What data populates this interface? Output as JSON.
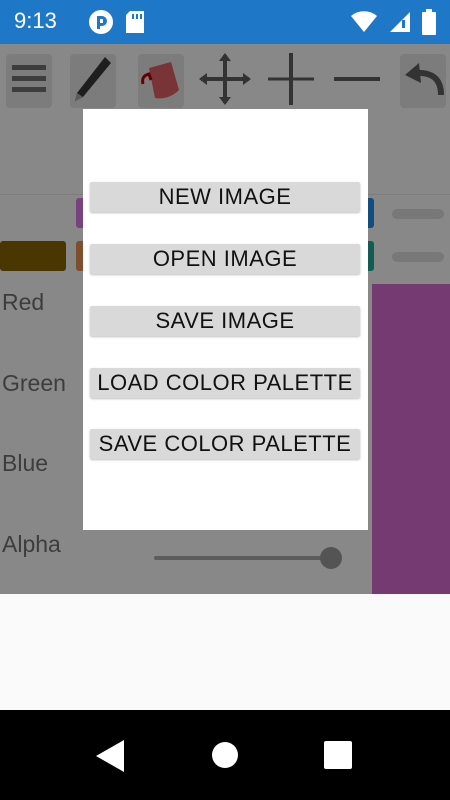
{
  "status_bar": {
    "time": "9:13",
    "left_icons": [
      "notification-app-icon",
      "sd-card-icon"
    ],
    "right_icons": [
      "wifi-icon",
      "cell-signal-icon",
      "battery-icon"
    ]
  },
  "toolbar": {
    "tools": [
      "menu-icon",
      "pencil-icon",
      "paint-bucket-icon",
      "move-icon",
      "vertical-line-icon",
      "horizontal-line-icon",
      "undo-icon"
    ]
  },
  "sliders": {
    "red_label": "Red",
    "green_label": "Green",
    "blue_label": "Blue",
    "alpha_label": "Alpha",
    "alpha_value": 1.0
  },
  "palette": {
    "swatches": [
      "#7a5a00",
      "#d2834b",
      "#c76ed1",
      "#1f7fd6",
      "#1f9a8a"
    ]
  },
  "color_preview": {
    "color": "#c561c0"
  },
  "dialog": {
    "new_image": "NEW IMAGE",
    "open_image": "OPEN IMAGE",
    "save_image": "SAVE IMAGE",
    "load_color_palette": "LOAD COLOR PALETTE",
    "save_color_palette": "SAVE COLOR PALETTE"
  },
  "nav_bar": {
    "buttons": [
      "back-icon",
      "home-icon",
      "recents-icon"
    ]
  }
}
